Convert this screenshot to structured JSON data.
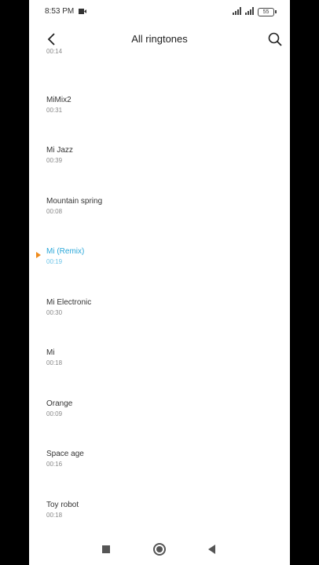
{
  "status_bar": {
    "time": "8:53 PM",
    "battery": "55"
  },
  "header": {
    "title": "All ringtones",
    "back_icon": "chevron-left-icon",
    "search_icon": "search-icon"
  },
  "ringtones": [
    {
      "name": "",
      "duration": "00:14",
      "selected": false
    },
    {
      "name": "MiMix2",
      "duration": "00:31",
      "selected": false
    },
    {
      "name": "Mi Jazz",
      "duration": "00:39",
      "selected": false
    },
    {
      "name": "Mountain spring",
      "duration": "00:08",
      "selected": false
    },
    {
      "name": "Mi (Remix)",
      "duration": "00:19",
      "selected": true
    },
    {
      "name": "Mi Electronic",
      "duration": "00:30",
      "selected": false
    },
    {
      "name": "Mi",
      "duration": "00:18",
      "selected": false
    },
    {
      "name": "Orange",
      "duration": "00:09",
      "selected": false
    },
    {
      "name": "Space age",
      "duration": "00:16",
      "selected": false
    },
    {
      "name": "Toy robot",
      "duration": "00:18",
      "selected": false
    }
  ],
  "colors": {
    "selected_text": "#2aa7d9",
    "play_indicator": "#ef8a1b"
  },
  "nav_bar": {
    "recent_icon": "square-icon",
    "home_icon": "circle-icon",
    "back_icon": "triangle-back-icon"
  }
}
